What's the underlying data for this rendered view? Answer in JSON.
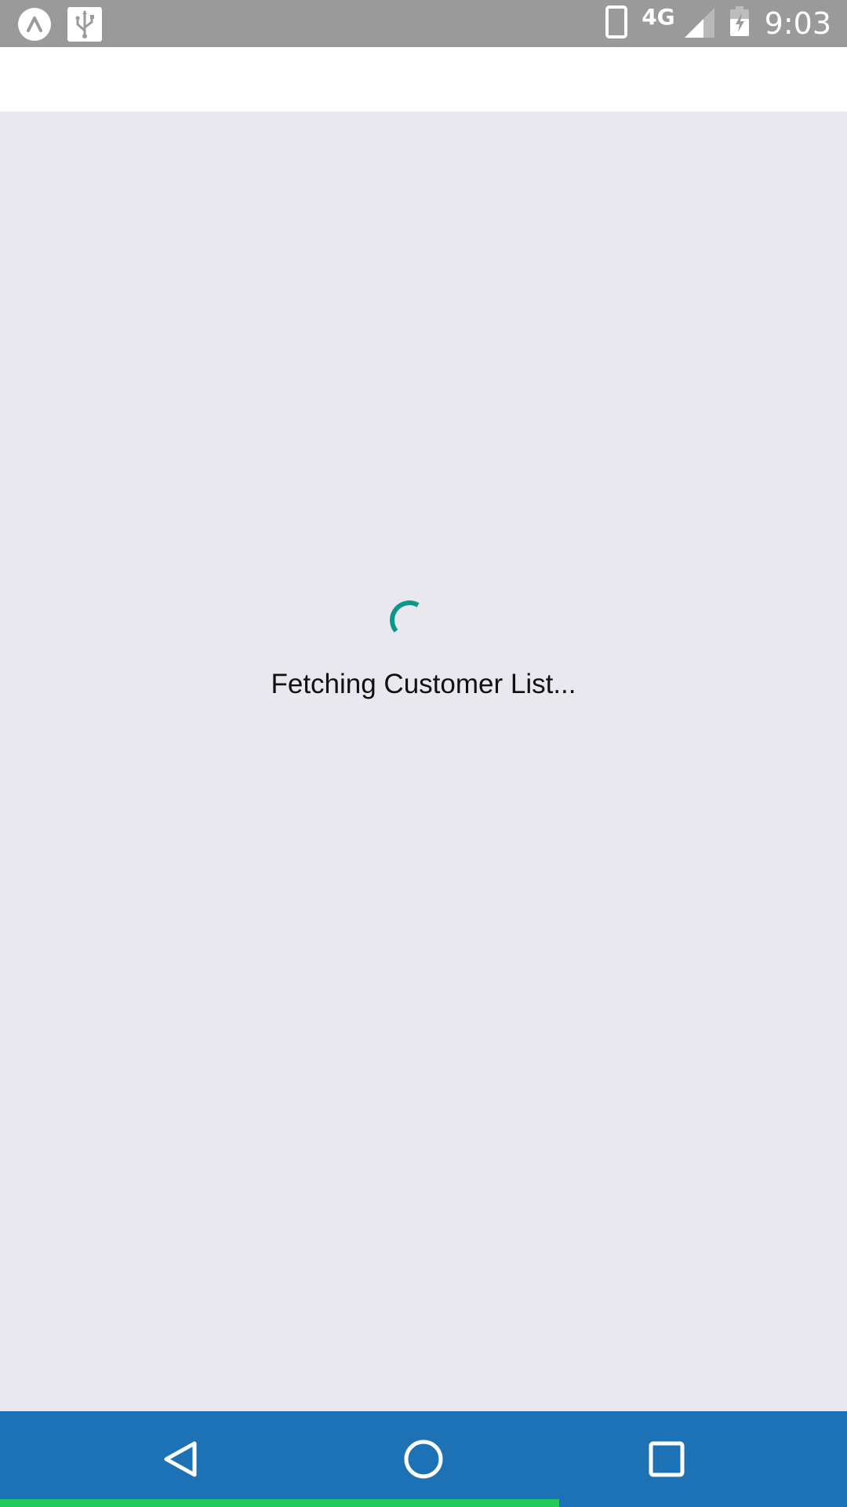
{
  "status_bar": {
    "time": "9:03",
    "network_label": "4G",
    "icons": [
      "app-launcher-icon",
      "usb-icon",
      "phone-icon",
      "cell-signal-icon",
      "battery-charging-icon"
    ]
  },
  "content": {
    "loading_message": "Fetching Customer List..."
  },
  "nav_bar": {
    "buttons": [
      "back-icon",
      "home-icon",
      "recents-icon"
    ]
  },
  "progress": {
    "fraction": 0.66
  },
  "colors": {
    "status_bar": "#9a9a9a",
    "app_bar": "#ffffff",
    "background": "#e8e8ee",
    "spinner": "#0f968a",
    "nav_bar": "#1c72b5",
    "progress": "#1fca57"
  }
}
